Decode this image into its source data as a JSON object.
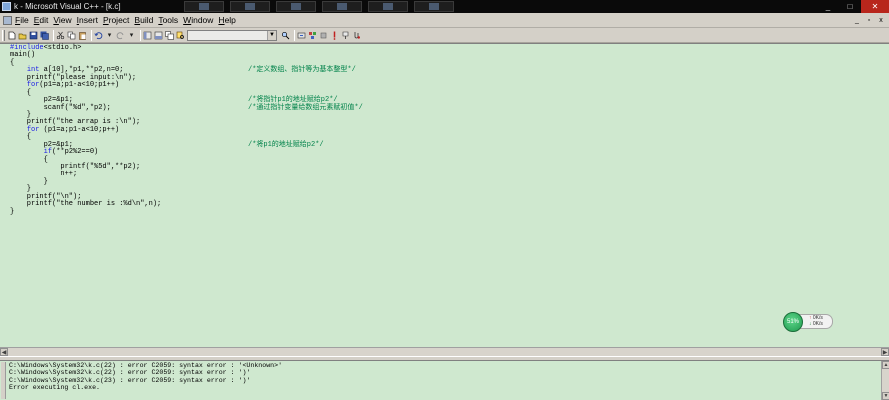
{
  "window": {
    "title": "k - Microsoft Visual C++ - [k.c]",
    "controls": [
      "_",
      "□",
      "✕"
    ]
  },
  "menu": {
    "items": [
      {
        "label": "File",
        "accel": "F"
      },
      {
        "label": "Edit",
        "accel": "E"
      },
      {
        "label": "View",
        "accel": "V"
      },
      {
        "label": "Insert",
        "accel": "I"
      },
      {
        "label": "Project",
        "accel": "P"
      },
      {
        "label": "Build",
        "accel": "B"
      },
      {
        "label": "Tools",
        "accel": "T"
      },
      {
        "label": "Window",
        "accel": "W"
      },
      {
        "label": "Help",
        "accel": "H"
      }
    ],
    "mdi_controls": [
      "_",
      "▫",
      "x"
    ]
  },
  "toolbar": {
    "icons": [
      "new-file-icon",
      "open-icon",
      "save-icon",
      "save-all-icon",
      "cut-icon",
      "copy-icon",
      "paste-icon",
      "undo-icon",
      "redo-icon",
      "workspace-icon",
      "output-icon",
      "window-list-icon",
      "find-in-files-icon",
      "find-icon",
      "compile-icon",
      "build-icon",
      "stop-build-icon",
      "execute-icon",
      "go-icon",
      "insert-breakpoint-icon"
    ],
    "combo_value": ""
  },
  "editor": {
    "background": "#cfe8cf",
    "keyword_color": "#1a1ae6",
    "comment_color": "#00824a",
    "lines": [
      {
        "code": "#include<stdio.h>",
        "comment": ""
      },
      {
        "code": "main()",
        "comment": ""
      },
      {
        "code": "{",
        "comment": ""
      },
      {
        "code": "    int a[10],*p1,**p2,n=0;",
        "comment": "/*定义数组、指针等为基本整型*/"
      },
      {
        "code": "    printf(\"please input:\\n\");",
        "comment": ""
      },
      {
        "code": "    for(p1=a;p1-a<10;p1++)",
        "comment": ""
      },
      {
        "code": "    {",
        "comment": ""
      },
      {
        "code": "        p2=&p1;",
        "comment": "/*将指针p1的地址赋给p2*/"
      },
      {
        "code": "        scanf(\"%d\",*p2);",
        "comment": "/*通过指针变量给数组元素赋初值*/"
      },
      {
        "code": "    }",
        "comment": ""
      },
      {
        "code": "    printf(\"the arrap is :\\n\");",
        "comment": ""
      },
      {
        "code": "    for (p1=a;p1-a<10;p++)",
        "comment": ""
      },
      {
        "code": "    {",
        "comment": ""
      },
      {
        "code": "        p2=&p1;",
        "comment": "/*将p1的地址赋给p2*/"
      },
      {
        "code": "        if(**p2%2==0)",
        "comment": ""
      },
      {
        "code": "        {",
        "comment": ""
      },
      {
        "code": "            printf(\"%5d\",**p2);",
        "comment": ""
      },
      {
        "code": "            n++;",
        "comment": ""
      },
      {
        "code": "        }",
        "comment": ""
      },
      {
        "code": "    }",
        "comment": ""
      },
      {
        "code": "    printf(\"\\n\");",
        "comment": ""
      },
      {
        "code": "    printf(\"the number is :%d\\n\",n);",
        "comment": ""
      },
      {
        "code": "}",
        "comment": ""
      }
    ]
  },
  "net_widget": {
    "percent": "51%",
    "up_rate": "0K/s",
    "down_rate": "0K/s",
    "up_arrow": "↑",
    "down_arrow": "↓"
  },
  "output": {
    "lines": [
      "C:\\Windows\\System32\\k.c(22) : error C2059: syntax error : '<Unknown>'",
      "C:\\Windows\\System32\\k.c(22) : error C2059: syntax error : ')'",
      "C:\\Windows\\System32\\k.c(23) : error C2059: syntax error : ')'",
      "Error executing cl.exe."
    ]
  }
}
